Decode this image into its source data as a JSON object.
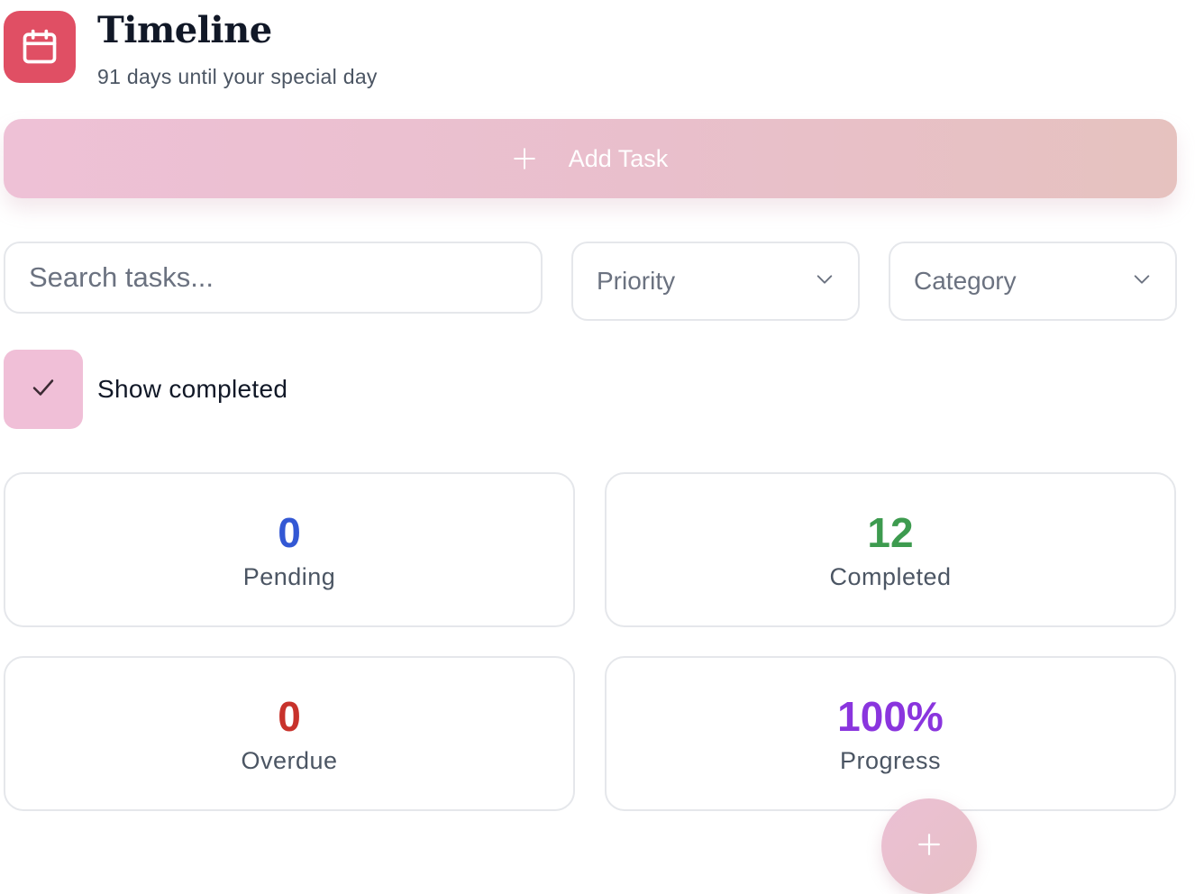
{
  "header": {
    "title": "Timeline",
    "subtitle": "91 days until your special day",
    "icon": "calendar-icon"
  },
  "add_task": {
    "label": "Add Task",
    "icon": "plus-icon"
  },
  "filters": {
    "search_placeholder": "Search tasks...",
    "priority_label": "Priority",
    "category_label": "Category"
  },
  "show_completed": {
    "label": "Show completed",
    "checked": true
  },
  "stats": {
    "pending": {
      "value": "0",
      "label": "Pending",
      "color": "#3358d4"
    },
    "completed": {
      "value": "12",
      "label": "Completed",
      "color": "#3d9b4f"
    },
    "overdue": {
      "value": "0",
      "label": "Overdue",
      "color": "#c8322b"
    },
    "progress": {
      "value": "100%",
      "label": "Progress",
      "color": "#8a35de"
    }
  },
  "colors": {
    "brand": "#e04f64",
    "accent_pink": "#eec1d6"
  }
}
